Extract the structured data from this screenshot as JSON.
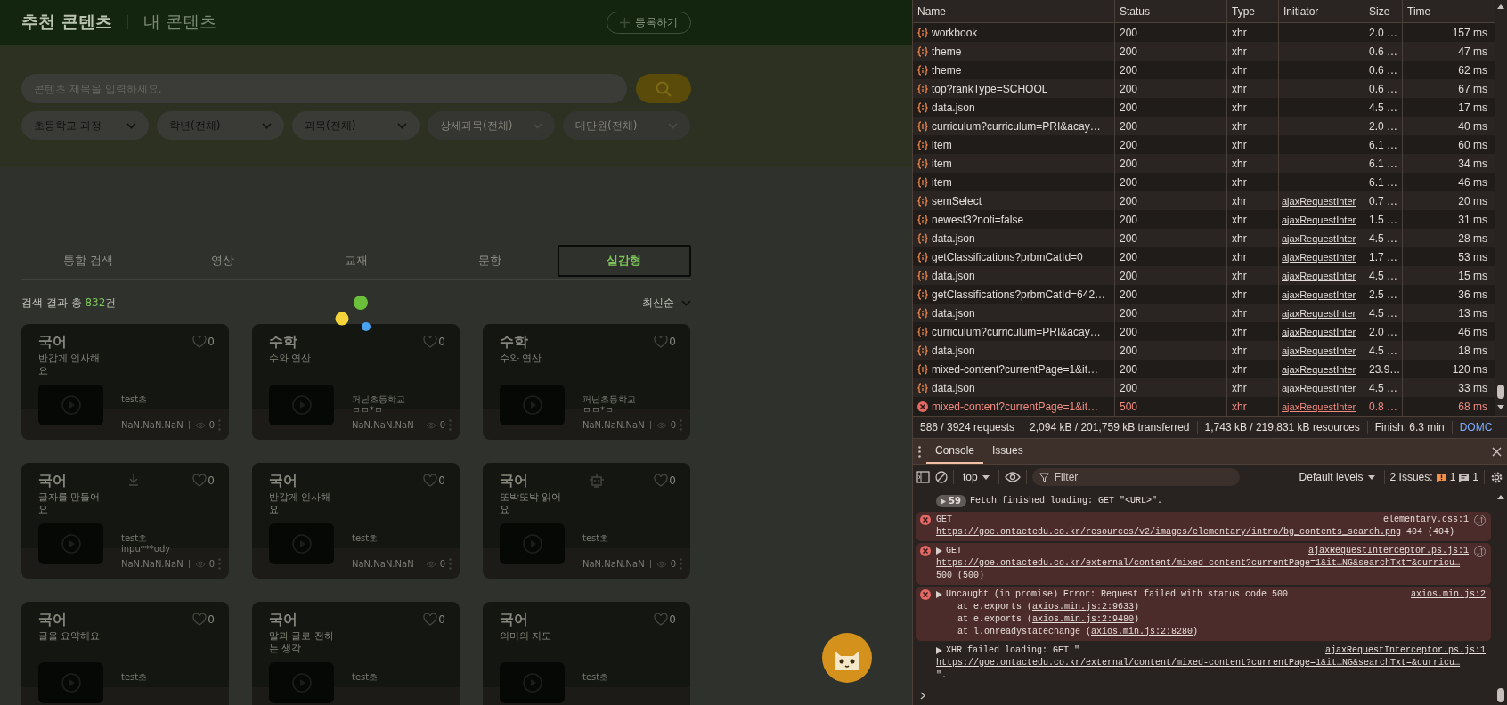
{
  "page": {
    "header": {
      "tabs": [
        {
          "label": "추천 콘텐츠",
          "selected": true
        },
        {
          "label": "내 콘텐츠",
          "selected": false
        }
      ],
      "register_button": "등록하기"
    },
    "search": {
      "placeholder": "콘텐츠 제목을 입력하세요."
    },
    "filters": [
      {
        "label": "초등학교 과정",
        "disabled": false
      },
      {
        "label": "학년(전체)",
        "disabled": false
      },
      {
        "label": "과목(전체)",
        "disabled": false
      },
      {
        "label": "상세과목(전체)",
        "disabled": true
      },
      {
        "label": "대단원(전체)",
        "disabled": true
      }
    ],
    "content_tabs": [
      {
        "label": "통합 검색",
        "selected": false
      },
      {
        "label": "영상",
        "selected": false
      },
      {
        "label": "교재",
        "selected": false
      },
      {
        "label": "문항",
        "selected": false
      },
      {
        "label": "실감형",
        "selected": true
      }
    ],
    "result": {
      "prefix": "검색 결과 총 ",
      "count": "832",
      "suffix": "건"
    },
    "sort": "최신순",
    "cards": [
      {
        "kind": "plain",
        "subject": "국어",
        "title": "반갑게 인사해요",
        "likes": "0",
        "authors": [
          "test초"
        ],
        "date": "NaN.NaN.NaN",
        "views": "0"
      },
      {
        "kind": "plain",
        "subject": "수학",
        "title": "수와 연산",
        "likes": "0",
        "authors": [
          "퍼닌초등학교",
          "ㅁㅁ*ㅁ"
        ],
        "date": "NaN.NaN.NaN",
        "views": "0"
      },
      {
        "kind": "plain",
        "subject": "수학",
        "title": "수와 연산",
        "likes": "0",
        "authors": [
          "퍼닌초등학교",
          "ㅁㅁ*ㅁ"
        ],
        "date": "NaN.NaN.NaN",
        "views": "0"
      },
      {
        "kind": "download",
        "subject": "국어",
        "title": "글자를 만들어요",
        "likes": "0",
        "authors": [
          "test초",
          "inpu***ody"
        ],
        "date": "NaN.NaN.NaN",
        "views": "0"
      },
      {
        "kind": "plain",
        "subject": "국어",
        "title": "반갑게 인사해요",
        "likes": "0",
        "authors": [
          "test초"
        ],
        "date": "NaN.NaN.NaN",
        "views": "0"
      },
      {
        "kind": "device",
        "subject": "국어",
        "title": "또박또박 읽어요",
        "likes": "0",
        "authors": [
          "test초"
        ],
        "date": "NaN.NaN.NaN",
        "views": "0"
      },
      {
        "kind": "plain",
        "subject": "국어",
        "title": "글을 요약해요",
        "likes": "0",
        "authors": [
          "test초"
        ]
      },
      {
        "kind": "plain",
        "subject": "국어",
        "title": "말과 글로 전하는 생각",
        "likes": "0",
        "authors": [
          "test초"
        ]
      },
      {
        "kind": "plain",
        "subject": "국어",
        "title": "의미의 지도",
        "likes": "0",
        "authors": [
          "test초"
        ]
      }
    ]
  },
  "devtools": {
    "network": {
      "columns": [
        "Name",
        "Status",
        "Type",
        "Initiator",
        "Size",
        "Time"
      ],
      "rows": [
        {
          "name": "workbook",
          "status": "200",
          "type": "xhr",
          "size": "2.0 …",
          "time": "157 ms",
          "failed": false
        },
        {
          "name": "theme",
          "status": "200",
          "type": "xhr",
          "size": "0.6 …",
          "time": "47 ms",
          "failed": false
        },
        {
          "name": "theme",
          "status": "200",
          "type": "xhr",
          "size": "0.6 …",
          "time": "62 ms",
          "failed": false
        },
        {
          "name": "top?rankType=SCHOOL",
          "status": "200",
          "type": "xhr",
          "size": "0.6 …",
          "time": "67 ms",
          "failed": false
        },
        {
          "name": "data.json",
          "status": "200",
          "type": "xhr",
          "size": "4.5 …",
          "time": "17 ms",
          "failed": false
        },
        {
          "name": "curriculum?curriculum=PRI&acay…",
          "status": "200",
          "type": "xhr",
          "size": "2.0 …",
          "time": "40 ms",
          "failed": false
        },
        {
          "name": "item",
          "status": "200",
          "type": "xhr",
          "size": "6.1 …",
          "time": "60 ms",
          "failed": false
        },
        {
          "name": "item",
          "status": "200",
          "type": "xhr",
          "size": "6.1 …",
          "time": "34 ms",
          "failed": false
        },
        {
          "name": "item",
          "status": "200",
          "type": "xhr",
          "size": "6.1 …",
          "time": "46 ms",
          "failed": false
        },
        {
          "name": "semSelect",
          "status": "200",
          "type": "xhr",
          "initiator": "ajaxRequestInter",
          "size": "0.7 …",
          "time": "20 ms",
          "failed": false
        },
        {
          "name": "newest3?noti=false",
          "status": "200",
          "type": "xhr",
          "initiator": "ajaxRequestInter",
          "size": "1.5 …",
          "time": "31 ms",
          "failed": false
        },
        {
          "name": "data.json",
          "status": "200",
          "type": "xhr",
          "initiator": "ajaxRequestInter",
          "size": "4.5 …",
          "time": "28 ms",
          "failed": false
        },
        {
          "name": "getClassifications?prbmCatId=0",
          "status": "200",
          "type": "xhr",
          "initiator": "ajaxRequestInter",
          "size": "1.7 …",
          "time": "53 ms",
          "failed": false
        },
        {
          "name": "data.json",
          "status": "200",
          "type": "xhr",
          "initiator": "ajaxRequestInter",
          "size": "4.5 …",
          "time": "15 ms",
          "failed": false
        },
        {
          "name": "getClassifications?prbmCatId=642…",
          "status": "200",
          "type": "xhr",
          "initiator": "ajaxRequestInter",
          "size": "2.5 …",
          "time": "36 ms",
          "failed": false
        },
        {
          "name": "data.json",
          "status": "200",
          "type": "xhr",
          "initiator": "ajaxRequestInter",
          "size": "4.5 …",
          "time": "13 ms",
          "failed": false
        },
        {
          "name": "curriculum?curriculum=PRI&acay…",
          "status": "200",
          "type": "xhr",
          "initiator": "ajaxRequestInter",
          "size": "2.0 …",
          "time": "46 ms",
          "failed": false
        },
        {
          "name": "data.json",
          "status": "200",
          "type": "xhr",
          "initiator": "ajaxRequestInter",
          "size": "4.5 …",
          "time": "18 ms",
          "failed": false
        },
        {
          "name": "mixed-content?currentPage=1&it…",
          "status": "200",
          "type": "xhr",
          "initiator": "ajaxRequestInter",
          "size": "23.9…",
          "time": "120 ms",
          "failed": false
        },
        {
          "name": "data.json",
          "status": "200",
          "type": "xhr",
          "initiator": "ajaxRequestInter",
          "size": "4.5 …",
          "time": "33 ms",
          "failed": false
        },
        {
          "name": "mixed-content?currentPage=1&it…",
          "status": "500",
          "type": "xhr",
          "initiator": "ajaxRequestInter",
          "size": "0.8 …",
          "time": "68 ms",
          "failed": true
        }
      ],
      "summary": [
        "586 / 3924 requests",
        "2,094 kB / 201,759 kB transferred",
        "1,743 kB / 219,831 kB resources",
        "Finish: 6.3 min"
      ],
      "summary_link": "DOMC"
    },
    "console": {
      "tabs": [
        {
          "label": "Console",
          "selected": true
        },
        {
          "label": "Issues",
          "selected": false
        }
      ],
      "context": "top",
      "filter_placeholder": "Filter",
      "levels": "Default levels",
      "issues_label": "2 Issues:",
      "issue_counts": [
        {
          "kind": "warning",
          "count": "1"
        },
        {
          "kind": "info",
          "count": "1"
        }
      ],
      "messages": [
        {
          "kind": "log",
          "collapsible": false,
          "count": "59",
          "text": "Fetch finished loading: GET \"<URL>\"."
        },
        {
          "kind": "error",
          "collapsible": false,
          "text": "GET",
          "source": "elementary.css:1",
          "request_icon": true,
          "url": "https://goe.ontactedu.co.kr/resources/v2/images/elementary/intro/bg_contents_search.png",
          "url_suffix": " 404 (404)"
        },
        {
          "kind": "error",
          "collapsible": true,
          "text": "GET",
          "source": "ajaxRequestInterceptor.ps.js:1",
          "request_icon": true,
          "url": "https://goe.ontactedu.co.kr/external/content/mixed-content?currentPage=1&it…NG&searchTxt=&curricu…",
          "next_line": "500 (500)"
        },
        {
          "kind": "error",
          "collapsible": true,
          "text": "Uncaught (in promise) Error: Request failed with status code 500",
          "source": "axios.min.js:2",
          "request_icon": false,
          "stack": [
            {
              "before": "at e.exports (",
              "link": "axios.min.js:2:9633",
              "after": ")"
            },
            {
              "before": "at e.exports (",
              "link": "axios.min.js:2:9480",
              "after": ")"
            },
            {
              "before": "at l.onreadystatechange (",
              "link": "axios.min.js:2:8280",
              "after": ")"
            }
          ]
        },
        {
          "kind": "log",
          "collapsible": true,
          "text": "XHR failed loading: GET \"",
          "source": "ajaxRequestInterceptor.ps.js:1",
          "request_icon": false,
          "url": "https://goe.ontactedu.co.kr/external/content/mixed-content?currentPage=1&it…NG&searchTxt=&curricu…",
          "next_line": "\"."
        }
      ]
    }
  }
}
